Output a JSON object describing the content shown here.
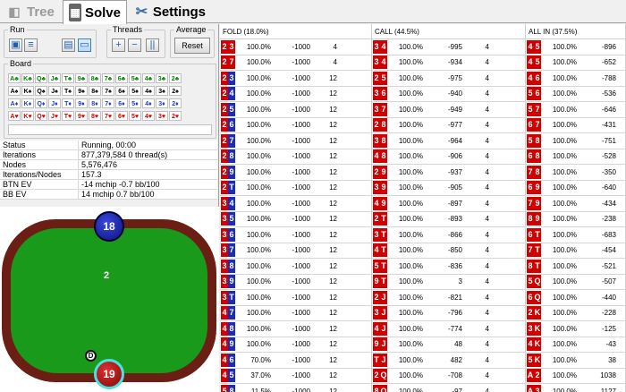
{
  "tabs": [
    {
      "label": "Tree"
    },
    {
      "label": "Solve"
    },
    {
      "label": "Settings"
    }
  ],
  "run": {
    "title": "Run"
  },
  "threads": {
    "title": "Threads",
    "plus": "+",
    "minus": "−",
    "pause": "||"
  },
  "average": {
    "title": "Average",
    "reset_label": "Reset"
  },
  "board": {
    "title": "Board",
    "rows": [
      {
        "suit": "c",
        "cards": [
          "A♣",
          "K♣",
          "Q♣",
          "J♣",
          "T♣",
          "9♣",
          "8♣",
          "7♣",
          "6♣",
          "5♣",
          "4♣",
          "3♣",
          "2♣"
        ]
      },
      {
        "suit": "s",
        "cards": [
          "A♠",
          "K♠",
          "Q♠",
          "J♠",
          "T♠",
          "9♠",
          "8♠",
          "7♠",
          "6♠",
          "5♠",
          "4♠",
          "3♠",
          "2♠"
        ]
      },
      {
        "suit": "d",
        "cards": [
          "A♦",
          "K♦",
          "Q♦",
          "J♦",
          "T♦",
          "9♦",
          "8♦",
          "7♦",
          "6♦",
          "5♦",
          "4♦",
          "3♦",
          "2♦"
        ]
      },
      {
        "suit": "h",
        "cards": [
          "A♥",
          "K♥",
          "Q♥",
          "J♥",
          "T♥",
          "9♥",
          "8♥",
          "7♥",
          "6♥",
          "5♥",
          "4♥",
          "3♥",
          "2♥"
        ]
      }
    ]
  },
  "info": [
    {
      "key": "Status",
      "value": "Running, 00:00"
    },
    {
      "key": "Iterations",
      "value": "877,379,584   0 thread(s)"
    },
    {
      "key": "Nodes",
      "value": "5,576,476"
    },
    {
      "key": "Iterations/Nodes",
      "value": "157.3"
    },
    {
      "key": "BTN EV",
      "value": "-14 mchip    -0.7 bb/100"
    },
    {
      "key": "BB EV",
      "value": "14 mchip   0.7 bb/100"
    }
  ],
  "table": {
    "top_stack": "18",
    "top_label": "2",
    "bottom_stack": "19",
    "bottom_label": "1",
    "dealer": "D",
    "felt_color": "#1a9a1a",
    "rail_color": "#6b1e14"
  },
  "grid": {
    "headers": [
      "FOLD (18.0%)",
      "CALL (44.5%)",
      "ALL IN (37.5%)"
    ],
    "rows": [
      {
        "fold": {
          "c1": "2",
          "s1": "h",
          "c2": "3",
          "s2": "h",
          "pct": "100.0%",
          "ev": "-1000",
          "n": "4"
        },
        "call": {
          "c1": "3",
          "s1": "h",
          "c2": "4",
          "s2": "h",
          "pct": "100.0%",
          "ev": "-995",
          "n": "4"
        },
        "allin": {
          "c1": "4",
          "s1": "h",
          "c2": "5",
          "s2": "h",
          "pct": "100.0%",
          "ev": "-896"
        }
      },
      {
        "fold": {
          "c1": "2",
          "s1": "h",
          "c2": "7",
          "s2": "h",
          "pct": "100.0%",
          "ev": "-1000",
          "n": "4"
        },
        "call": {
          "c1": "3",
          "s1": "h",
          "c2": "4",
          "s2": "h",
          "pct": "100.0%",
          "ev": "-934",
          "n": "4"
        },
        "allin": {
          "c1": "4",
          "s1": "h",
          "c2": "5",
          "s2": "h",
          "pct": "100.0%",
          "ev": "-652"
        }
      },
      {
        "fold": {
          "c1": "2",
          "s1": "h",
          "c2": "3",
          "s2": "d",
          "pct": "100.0%",
          "ev": "-1000",
          "n": "12"
        },
        "call": {
          "c1": "2",
          "s1": "h",
          "c2": "5",
          "s2": "h",
          "pct": "100.0%",
          "ev": "-975",
          "n": "4"
        },
        "allin": {
          "c1": "4",
          "s1": "h",
          "c2": "6",
          "s2": "h",
          "pct": "100.0%",
          "ev": "-788"
        }
      },
      {
        "fold": {
          "c1": "2",
          "s1": "h",
          "c2": "4",
          "s2": "d",
          "pct": "100.0%",
          "ev": "-1000",
          "n": "12"
        },
        "call": {
          "c1": "3",
          "s1": "h",
          "c2": "6",
          "s2": "h",
          "pct": "100.0%",
          "ev": "-940",
          "n": "4"
        },
        "allin": {
          "c1": "5",
          "s1": "h",
          "c2": "6",
          "s2": "h",
          "pct": "100.0%",
          "ev": "-536"
        }
      },
      {
        "fold": {
          "c1": "2",
          "s1": "h",
          "c2": "5",
          "s2": "d",
          "pct": "100.0%",
          "ev": "-1000",
          "n": "12"
        },
        "call": {
          "c1": "3",
          "s1": "h",
          "c2": "7",
          "s2": "h",
          "pct": "100.0%",
          "ev": "-949",
          "n": "4"
        },
        "allin": {
          "c1": "5",
          "s1": "h",
          "c2": "7",
          "s2": "h",
          "pct": "100.0%",
          "ev": "-646"
        }
      },
      {
        "fold": {
          "c1": "2",
          "s1": "h",
          "c2": "6",
          "s2": "d",
          "pct": "100.0%",
          "ev": "-1000",
          "n": "12"
        },
        "call": {
          "c1": "2",
          "s1": "h",
          "c2": "8",
          "s2": "h",
          "pct": "100.0%",
          "ev": "-977",
          "n": "4"
        },
        "allin": {
          "c1": "6",
          "s1": "h",
          "c2": "7",
          "s2": "h",
          "pct": "100.0%",
          "ev": "-431"
        }
      },
      {
        "fold": {
          "c1": "2",
          "s1": "h",
          "c2": "7",
          "s2": "d",
          "pct": "100.0%",
          "ev": "-1000",
          "n": "12"
        },
        "call": {
          "c1": "3",
          "s1": "h",
          "c2": "8",
          "s2": "h",
          "pct": "100.0%",
          "ev": "-964",
          "n": "4"
        },
        "allin": {
          "c1": "5",
          "s1": "h",
          "c2": "8",
          "s2": "h",
          "pct": "100.0%",
          "ev": "-751"
        }
      },
      {
        "fold": {
          "c1": "2",
          "s1": "h",
          "c2": "8",
          "s2": "d",
          "pct": "100.0%",
          "ev": "-1000",
          "n": "12"
        },
        "call": {
          "c1": "4",
          "s1": "h",
          "c2": "8",
          "s2": "h",
          "pct": "100.0%",
          "ev": "-906",
          "n": "4"
        },
        "allin": {
          "c1": "6",
          "s1": "h",
          "c2": "8",
          "s2": "h",
          "pct": "100.0%",
          "ev": "-528"
        }
      },
      {
        "fold": {
          "c1": "2",
          "s1": "h",
          "c2": "9",
          "s2": "d",
          "pct": "100.0%",
          "ev": "-1000",
          "n": "12"
        },
        "call": {
          "c1": "2",
          "s1": "h",
          "c2": "9",
          "s2": "h",
          "pct": "100.0%",
          "ev": "-937",
          "n": "4"
        },
        "allin": {
          "c1": "7",
          "s1": "h",
          "c2": "8",
          "s2": "h",
          "pct": "100.0%",
          "ev": "-350"
        }
      },
      {
        "fold": {
          "c1": "2",
          "s1": "h",
          "c2": "T",
          "s2": "d",
          "pct": "100.0%",
          "ev": "-1000",
          "n": "12"
        },
        "call": {
          "c1": "3",
          "s1": "h",
          "c2": "9",
          "s2": "h",
          "pct": "100.0%",
          "ev": "-905",
          "n": "4"
        },
        "allin": {
          "c1": "6",
          "s1": "h",
          "c2": "9",
          "s2": "h",
          "pct": "100.0%",
          "ev": "-640"
        }
      },
      {
        "fold": {
          "c1": "3",
          "s1": "h",
          "c2": "4",
          "s2": "d",
          "pct": "100.0%",
          "ev": "-1000",
          "n": "12"
        },
        "call": {
          "c1": "4",
          "s1": "h",
          "c2": "9",
          "s2": "h",
          "pct": "100.0%",
          "ev": "-897",
          "n": "4"
        },
        "allin": {
          "c1": "7",
          "s1": "h",
          "c2": "9",
          "s2": "h",
          "pct": "100.0%",
          "ev": "-434"
        }
      },
      {
        "fold": {
          "c1": "3",
          "s1": "h",
          "c2": "5",
          "s2": "d",
          "pct": "100.0%",
          "ev": "-1000",
          "n": "12"
        },
        "call": {
          "c1": "2",
          "s1": "h",
          "c2": "T",
          "s2": "h",
          "pct": "100.0%",
          "ev": "-893",
          "n": "4"
        },
        "allin": {
          "c1": "8",
          "s1": "h",
          "c2": "9",
          "s2": "h",
          "pct": "100.0%",
          "ev": "-238"
        }
      },
      {
        "fold": {
          "c1": "3",
          "s1": "h",
          "c2": "6",
          "s2": "d",
          "pct": "100.0%",
          "ev": "-1000",
          "n": "12"
        },
        "call": {
          "c1": "3",
          "s1": "h",
          "c2": "T",
          "s2": "h",
          "pct": "100.0%",
          "ev": "-866",
          "n": "4"
        },
        "allin": {
          "c1": "6",
          "s1": "h",
          "c2": "T",
          "s2": "h",
          "pct": "100.0%",
          "ev": "-683"
        }
      },
      {
        "fold": {
          "c1": "3",
          "s1": "h",
          "c2": "7",
          "s2": "d",
          "pct": "100.0%",
          "ev": "-1000",
          "n": "12"
        },
        "call": {
          "c1": "4",
          "s1": "h",
          "c2": "T",
          "s2": "h",
          "pct": "100.0%",
          "ev": "-850",
          "n": "4"
        },
        "allin": {
          "c1": "7",
          "s1": "h",
          "c2": "T",
          "s2": "h",
          "pct": "100.0%",
          "ev": "-454"
        }
      },
      {
        "fold": {
          "c1": "3",
          "s1": "h",
          "c2": "8",
          "s2": "d",
          "pct": "100.0%",
          "ev": "-1000",
          "n": "12"
        },
        "call": {
          "c1": "5",
          "s1": "h",
          "c2": "T",
          "s2": "h",
          "pct": "100.0%",
          "ev": "-836",
          "n": "4"
        },
        "allin": {
          "c1": "8",
          "s1": "h",
          "c2": "T",
          "s2": "h",
          "pct": "100.0%",
          "ev": "-521"
        }
      },
      {
        "fold": {
          "c1": "3",
          "s1": "h",
          "c2": "9",
          "s2": "d",
          "pct": "100.0%",
          "ev": "-1000",
          "n": "12"
        },
        "call": {
          "c1": "9",
          "s1": "h",
          "c2": "T",
          "s2": "h",
          "pct": "100.0%",
          "ev": "3",
          "n": "4"
        },
        "allin": {
          "c1": "5",
          "s1": "h",
          "c2": "Q",
          "s2": "h",
          "pct": "100.0%",
          "ev": "-507"
        }
      },
      {
        "fold": {
          "c1": "3",
          "s1": "h",
          "c2": "T",
          "s2": "d",
          "pct": "100.0%",
          "ev": "-1000",
          "n": "12"
        },
        "call": {
          "c1": "2",
          "s1": "h",
          "c2": "J",
          "s2": "h",
          "pct": "100.0%",
          "ev": "-821",
          "n": "4"
        },
        "allin": {
          "c1": "6",
          "s1": "h",
          "c2": "Q",
          "s2": "h",
          "pct": "100.0%",
          "ev": "-440"
        }
      },
      {
        "fold": {
          "c1": "4",
          "s1": "h",
          "c2": "7",
          "s2": "d",
          "pct": "100.0%",
          "ev": "-1000",
          "n": "12"
        },
        "call": {
          "c1": "3",
          "s1": "h",
          "c2": "J",
          "s2": "h",
          "pct": "100.0%",
          "ev": "-796",
          "n": "4"
        },
        "allin": {
          "c1": "2",
          "s1": "h",
          "c2": "K",
          "s2": "h",
          "pct": "100.0%",
          "ev": "-228"
        }
      },
      {
        "fold": {
          "c1": "4",
          "s1": "h",
          "c2": "8",
          "s2": "d",
          "pct": "100.0%",
          "ev": "-1000",
          "n": "12"
        },
        "call": {
          "c1": "4",
          "s1": "h",
          "c2": "J",
          "s2": "h",
          "pct": "100.0%",
          "ev": "-774",
          "n": "4"
        },
        "allin": {
          "c1": "3",
          "s1": "h",
          "c2": "K",
          "s2": "h",
          "pct": "100.0%",
          "ev": "-125"
        }
      },
      {
        "fold": {
          "c1": "4",
          "s1": "h",
          "c2": "9",
          "s2": "d",
          "pct": "100.0%",
          "ev": "-1000",
          "n": "12"
        },
        "call": {
          "c1": "9",
          "s1": "h",
          "c2": "J",
          "s2": "h",
          "pct": "100.0%",
          "ev": "48",
          "n": "4"
        },
        "allin": {
          "c1": "4",
          "s1": "h",
          "c2": "K",
          "s2": "h",
          "pct": "100.0%",
          "ev": "-43"
        }
      },
      {
        "fold": {
          "c1": "4",
          "s1": "h",
          "c2": "6",
          "s2": "d",
          "pct": "70.0%",
          "ev": "-1000",
          "n": "12"
        },
        "call": {
          "c1": "T",
          "s1": "h",
          "c2": "J",
          "s2": "h",
          "pct": "100.0%",
          "ev": "482",
          "n": "4"
        },
        "allin": {
          "c1": "5",
          "s1": "h",
          "c2": "K",
          "s2": "h",
          "pct": "100.0%",
          "ev": "38"
        }
      },
      {
        "fold": {
          "c1": "4",
          "s1": "h",
          "c2": "5",
          "s2": "d",
          "pct": "37.0%",
          "ev": "-1000",
          "n": "12"
        },
        "call": {
          "c1": "2",
          "s1": "h",
          "c2": "Q",
          "s2": "h",
          "pct": "100.0%",
          "ev": "-708",
          "n": "4"
        },
        "allin": {
          "c1": "A",
          "s1": "h",
          "c2": "2",
          "s2": "h",
          "pct": "100.0%",
          "ev": "1038"
        }
      },
      {
        "fold": {
          "c1": "5",
          "s1": "h",
          "c2": "8",
          "s2": "d",
          "pct": "11.5%",
          "ev": "-1000",
          "n": "12"
        },
        "call": {
          "c1": "8",
          "s1": "h",
          "c2": "Q",
          "s2": "h",
          "pct": "100.0%",
          "ev": "-97",
          "n": "4"
        },
        "allin": {
          "c1": "A",
          "s1": "h",
          "c2": "3",
          "s2": "h",
          "pct": "100.0%",
          "ev": "1127"
        }
      }
    ]
  }
}
